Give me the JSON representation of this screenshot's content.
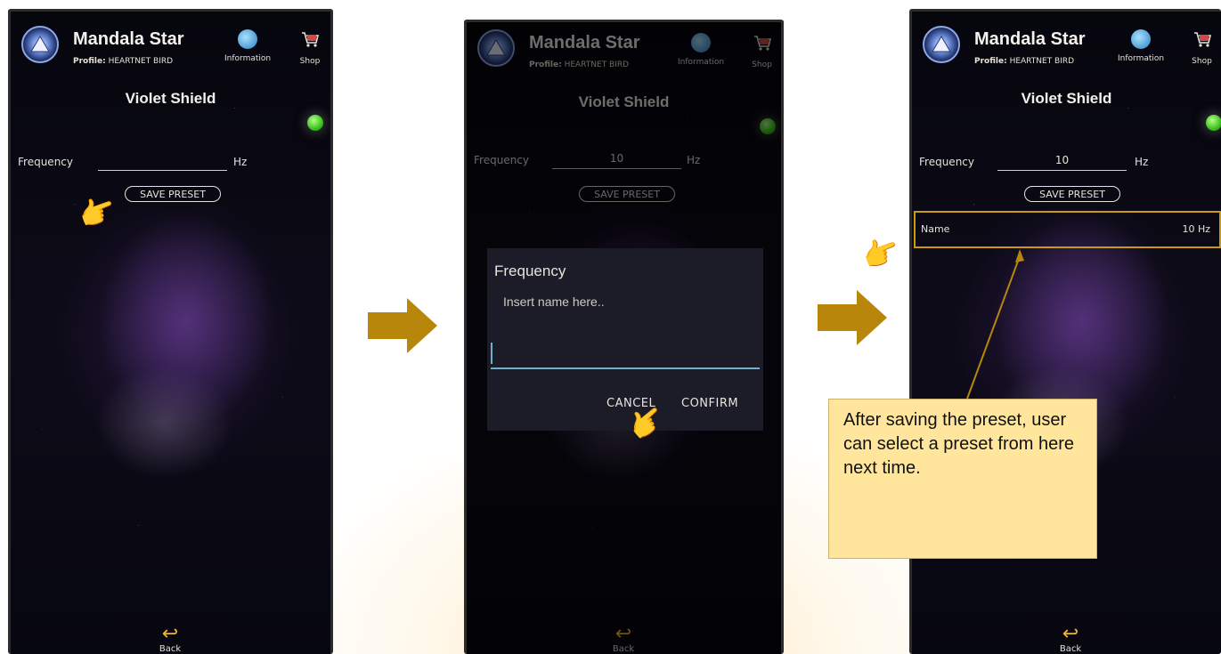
{
  "app": {
    "title": "Mandala Star",
    "profile_label": "Profile:",
    "profile_name": "HEARTNET BIRD",
    "info_label": "Information",
    "shop_label": "Shop"
  },
  "screen": {
    "title": "Violet Shield",
    "frequency_label": "Frequency",
    "unit": "Hz",
    "save_preset_label": "SAVE PRESET",
    "back_label": "Back"
  },
  "screens": [
    {
      "frequency_value": ""
    },
    {
      "frequency_value": "10"
    },
    {
      "frequency_value": "10"
    }
  ],
  "dialog": {
    "title": "Frequency",
    "placeholder": "Insert name here..",
    "cancel_label": "CANCEL",
    "confirm_label": "CONFIRM"
  },
  "preset": {
    "name": "Name",
    "value": "10 Hz"
  },
  "callout": {
    "text": "After saving the preset, user can select a preset from here next time."
  },
  "colors": {
    "arrow": "#b8860b",
    "highlight_border": "#c99a14",
    "callout_bg": "#ffe69c",
    "status_green": "#39c21d"
  },
  "icons": [
    "app-logo-icon",
    "information-icon",
    "shop-cart-icon",
    "back-arrow-icon",
    "pointing-hand-icon",
    "status-dot"
  ]
}
